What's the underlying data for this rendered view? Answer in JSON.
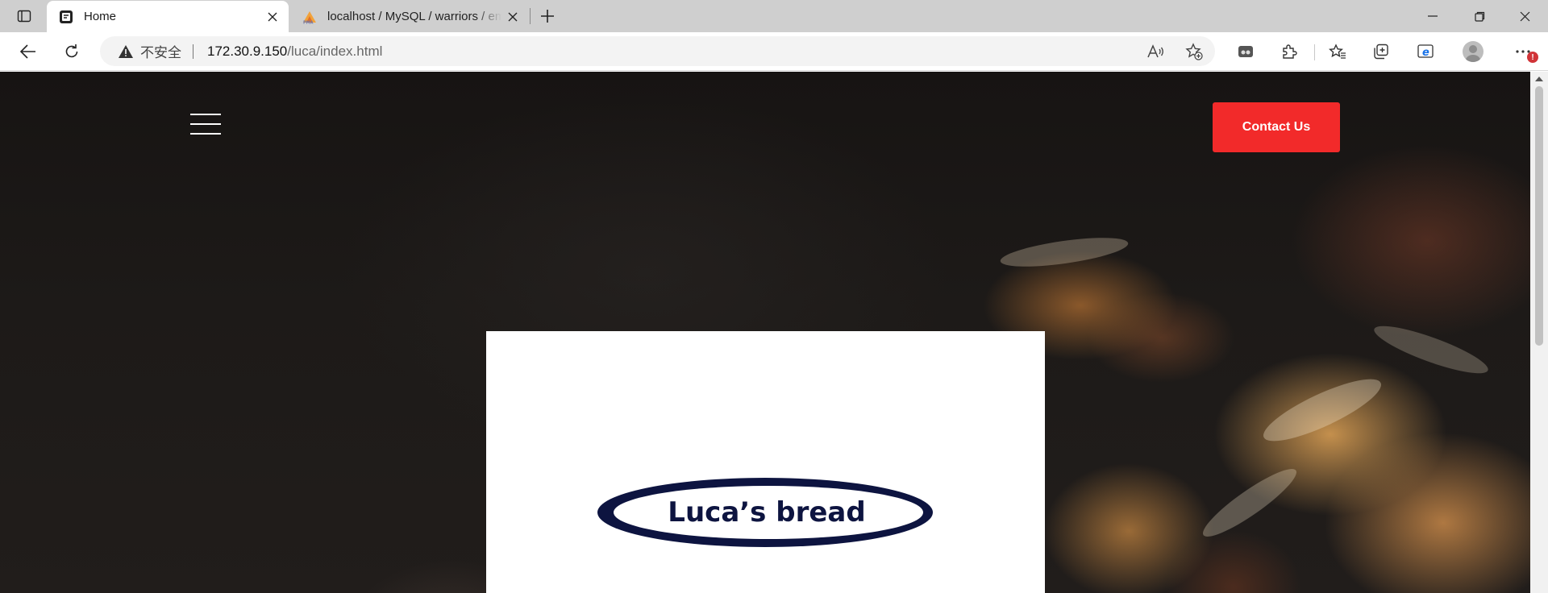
{
  "browser": {
    "tabs": [
      {
        "title": "Home",
        "favicon": "page-icon",
        "active": true
      },
      {
        "title": "localhost / MySQL / warriors / employees",
        "favicon": "phpmyadmin-icon",
        "active": false
      }
    ],
    "address": {
      "security_label": "不安全",
      "url_host": "172.30.9.150",
      "url_path": "/luca/index.html"
    },
    "notification_badge": "!"
  },
  "page": {
    "contact_button_label": "Contact Us",
    "logo_text": "Luca’s bread",
    "colors": {
      "contact_button": "#f22a2a",
      "logo_navy": "#0d1440",
      "hero_background": "#1d1a18"
    }
  }
}
